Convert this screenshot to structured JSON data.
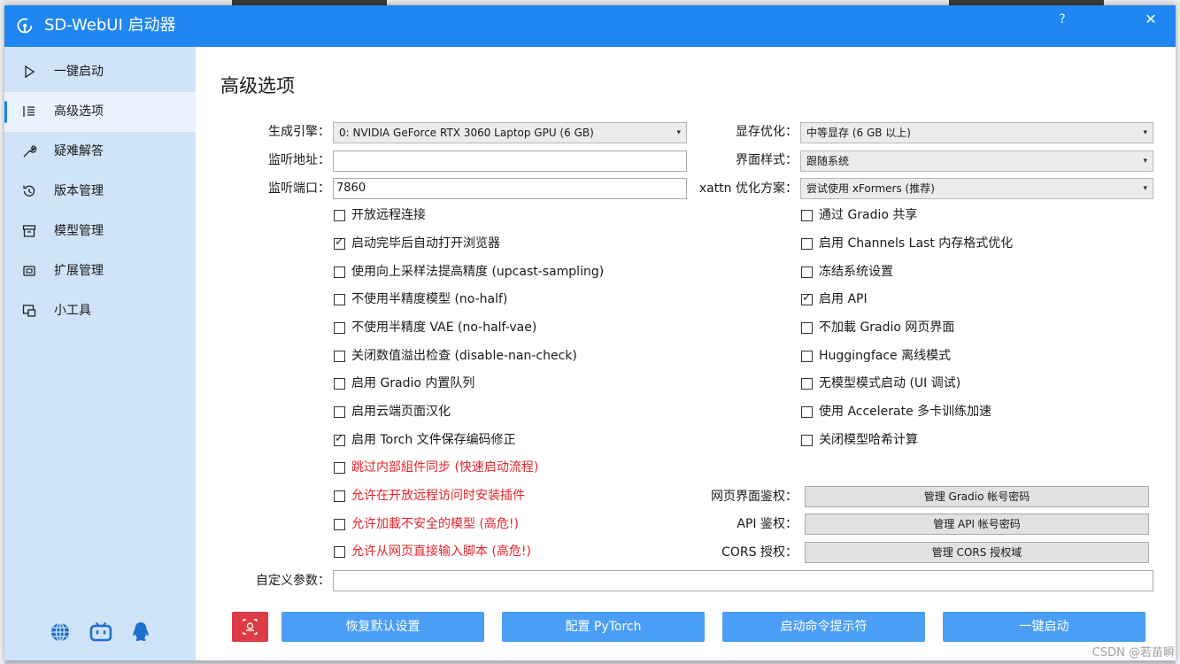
{
  "window": {
    "title": "SD-WebUI 启动器",
    "help_label": "?",
    "close_label": "✕"
  },
  "sidebar": {
    "items": [
      {
        "label": "一键启动",
        "icon": "play-icon"
      },
      {
        "label": "高级选项",
        "icon": "list-settings-icon",
        "active": true
      },
      {
        "label": "疑难解答",
        "icon": "wrench-icon"
      },
      {
        "label": "版本管理",
        "icon": "history-icon"
      },
      {
        "label": "模型管理",
        "icon": "archive-icon"
      },
      {
        "label": "扩展管理",
        "icon": "chip-icon"
      },
      {
        "label": "小工具",
        "icon": "toolbox-icon"
      }
    ],
    "footer_icons": [
      "globe-icon",
      "bilibili-icon",
      "qq-icon"
    ]
  },
  "page": {
    "title": "高级选项"
  },
  "form": {
    "engine_label": "生成引擎：",
    "engine_value": "0: NVIDIA GeForce RTX 3060 Laptop GPU (6 GB)",
    "listen_addr_label": "监听地址：",
    "listen_addr_value": "",
    "listen_port_label": "监听端口：",
    "listen_port_value": "7860",
    "vram_label": "显存优化：",
    "vram_value": "中等显存 (6 GB 以上)",
    "theme_label": "界面样式：",
    "theme_value": "跟随系统",
    "xattn_label": "xattn 优化方案：",
    "xattn_value": "尝试使用 xFormers (推荐)",
    "webauth_label": "网页界面鉴权：",
    "webauth_button": "管理 Gradio 帐号密码",
    "apiauth_label": "API 鉴权：",
    "apiauth_button": "管理 API 帐号密码",
    "cors_label": "CORS 授权：",
    "cors_button": "管理 CORS 授权域",
    "custom_args_label": "自定义参数：",
    "custom_args_value": ""
  },
  "left_checks": [
    {
      "label": "开放远程连接",
      "checked": false,
      "warn": false
    },
    {
      "label": "启动完毕后自动打开浏览器",
      "checked": true,
      "warn": false
    },
    {
      "label": "使用向上采样法提高精度 (upcast-sampling)",
      "checked": false,
      "warn": false
    },
    {
      "label": "不使用半精度模型 (no-half)",
      "checked": false,
      "warn": false
    },
    {
      "label": "不使用半精度 VAE (no-half-vae)",
      "checked": false,
      "warn": false
    },
    {
      "label": "关闭数值溢出检查 (disable-nan-check)",
      "checked": false,
      "warn": false
    },
    {
      "label": "启用 Gradio 内置队列",
      "checked": false,
      "warn": false
    },
    {
      "label": "启用云端页面汉化",
      "checked": false,
      "warn": false
    },
    {
      "label": "启用 Torch 文件保存编码修正",
      "checked": true,
      "warn": false
    },
    {
      "label": "跳过内部組件同步 (快速启动流程)",
      "checked": false,
      "warn": true
    },
    {
      "label": "允许在开放远程访问时安装插件",
      "checked": false,
      "warn": true
    },
    {
      "label": "允许加載不安全的模型 (高危!)",
      "checked": false,
      "warn": true
    },
    {
      "label": "允许从网页直接输入脚本 (高危!)",
      "checked": false,
      "warn": true
    }
  ],
  "right_checks": [
    {
      "label": "通过 Gradio 共享",
      "checked": false
    },
    {
      "label": "启用 Channels Last 内存格式优化",
      "checked": false
    },
    {
      "label": "冻结系统设置",
      "checked": false
    },
    {
      "label": "启用 API",
      "checked": true
    },
    {
      "label": "不加載 Gradio 网页界面",
      "checked": false
    },
    {
      "label": "Huggingface 离线模式",
      "checked": false
    },
    {
      "label": "无模型模式启动 (UI 调试)",
      "checked": false
    },
    {
      "label": "使用 Accelerate 多卡训练加速",
      "checked": false
    },
    {
      "label": "关闭模型哈希计算",
      "checked": false
    }
  ],
  "bottom": {
    "reset": "恢复默认设置",
    "pytorch": "配置 PyTorch",
    "cmd": "启动命令提示符",
    "launch": "一键启动"
  },
  "watermark": "CSDN @若苗瞬",
  "colors": {
    "accent": "#1f86f2",
    "sidebar_bg": "#cfe3f9",
    "button": "#4a9ef5",
    "danger": "#dd3b45",
    "warn_text": "#e5252c"
  }
}
